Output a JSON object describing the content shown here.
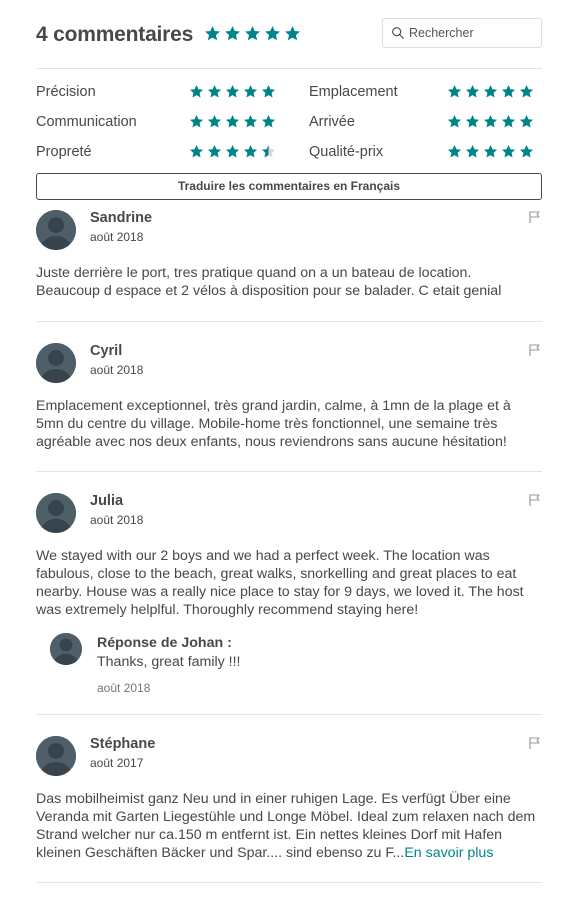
{
  "header": {
    "title": "4 commentaires",
    "overall_rating": 5,
    "search_placeholder": "Rechercher"
  },
  "colors": {
    "accent": "#008489",
    "text": "#484848",
    "divider": "#e4e4e4"
  },
  "ratings": [
    {
      "label": "Précision",
      "stars": 5
    },
    {
      "label": "Emplacement",
      "stars": 5
    },
    {
      "label": "Communication",
      "stars": 5
    },
    {
      "label": "Arrivée",
      "stars": 5
    },
    {
      "label": "Propreté",
      "stars": 4.5
    },
    {
      "label": "Qualité-prix",
      "stars": 5
    }
  ],
  "translate_button": "Traduire les commentaires en Français",
  "reviews": [
    {
      "name": "Sandrine",
      "date": "août 2018",
      "lines": [
        "Juste derrière le port, tres pratique quand on a un bateau de location.",
        "Beaucoup d espace et 2 vélos à disposition pour se balader. C etait genial"
      ]
    },
    {
      "name": "Cyril",
      "date": "août 2018",
      "lines": [
        "Emplacement exceptionnel, très grand jardin, calme, à 1mn de la plage et à",
        "5mn du centre du village. Mobile-home très fonctionnel, une semaine très",
        "agréable avec nos deux enfants, nous reviendrons sans aucune hésitation!"
      ]
    },
    {
      "name": "Julia",
      "date": "août 2018",
      "lines": [
        "We stayed with our 2 boys and we had a perfect week. The location was",
        "fabulous, close to the beach, great walks, snorkelling and great places to eat",
        "nearby. House was a really nice place to stay for 9 days, we loved it. The host",
        "was extremely helplful. Thoroughly recommend staying here!"
      ],
      "response": {
        "name": "Réponse de Johan :",
        "text": "Thanks, great family !!!",
        "date": "août 2018"
      }
    },
    {
      "name": "Stéphane",
      "date": "août 2017",
      "lines": [
        "Das mobilheimist ganz Neu und in einer ruhigen Lage. Es verfügt Über eine",
        "Veranda mit Garten Liegestühle und Longe Möbel. Ideal zum relaxen nach dem",
        "Strand welcher nur ca.150 m entfernt ist. Ein nettes kleines Dorf mit Hafen",
        "kleinen Geschäften Bäcker und Spar.... sind ebenso zu F..."
      ],
      "read_more": "En savoir plus"
    }
  ]
}
